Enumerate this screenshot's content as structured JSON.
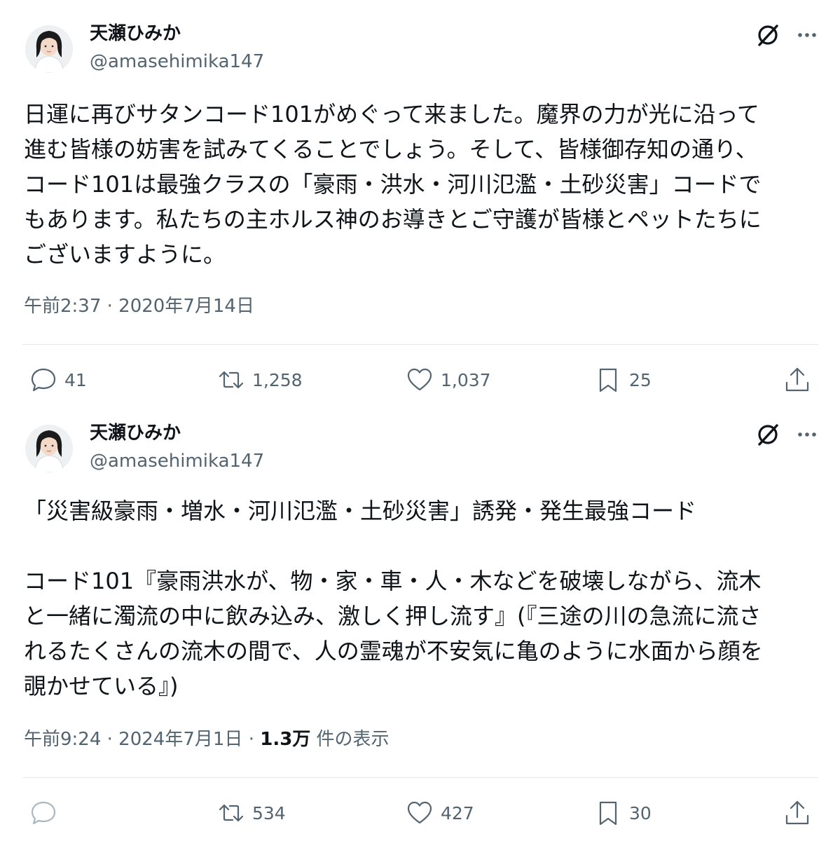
{
  "tweets": [
    {
      "author_name": "天瀬ひみか",
      "handle": "@amasehimika147",
      "text": "日運に再びサタンコード101がめぐって来ました。魔界の力が光に沿って\n進む皆様の妨害を試みてくることでしょう。そして、皆様御存知の通り、\nコード101は最強クラスの「豪雨・洪水・河川氾濫・土砂災害」コードで\nもあります。私たちの主ホルス神のお導きとご守護が皆様とペットたちに\nございますように。",
      "timestamp": "午前2:37 · 2020年7月14日",
      "views_count": "",
      "views_label": "",
      "replies": "41",
      "reposts": "1,258",
      "likes": "1,037",
      "bookmarks": "25",
      "icons": {
        "grok": "grok-icon",
        "more": "more-dots-icon",
        "reply": "reply-bubble-icon",
        "repost": "repost-arrows-icon",
        "like": "heart-icon",
        "bookmark": "bookmark-icon",
        "share": "share-upload-icon"
      }
    },
    {
      "author_name": "天瀬ひみか",
      "handle": "@amasehimika147",
      "text": "「災害級豪雨・増水・河川氾濫・土砂災害」誘発・発生最強コード\n\nコード101『豪雨洪水が、物・家・車・人・木などを破壊しながら、流木\nと一緒に濁流の中に飲み込み、激しく押し流す』(『三途の川の急流に流さ\nれるたくさんの流木の間で、人の霊魂が不安気に亀のように水面から顔を\n覗かせている』)",
      "timestamp": "午前9:24 · 2024年7月1日 · ",
      "views_count": "1.3万",
      "views_label": " 件の表示",
      "replies": "",
      "reposts": "534",
      "likes": "427",
      "bookmarks": "30",
      "icons": {
        "grok": "grok-icon",
        "more": "more-dots-icon",
        "reply": "reply-bubble-icon",
        "repost": "repost-arrows-icon",
        "like": "heart-icon",
        "bookmark": "bookmark-icon",
        "share": "share-upload-icon"
      }
    }
  ],
  "colors": {
    "text_primary": "#0f1419",
    "text_secondary": "#536471",
    "divider": "#e5e8eb",
    "background": "#ffffff"
  }
}
